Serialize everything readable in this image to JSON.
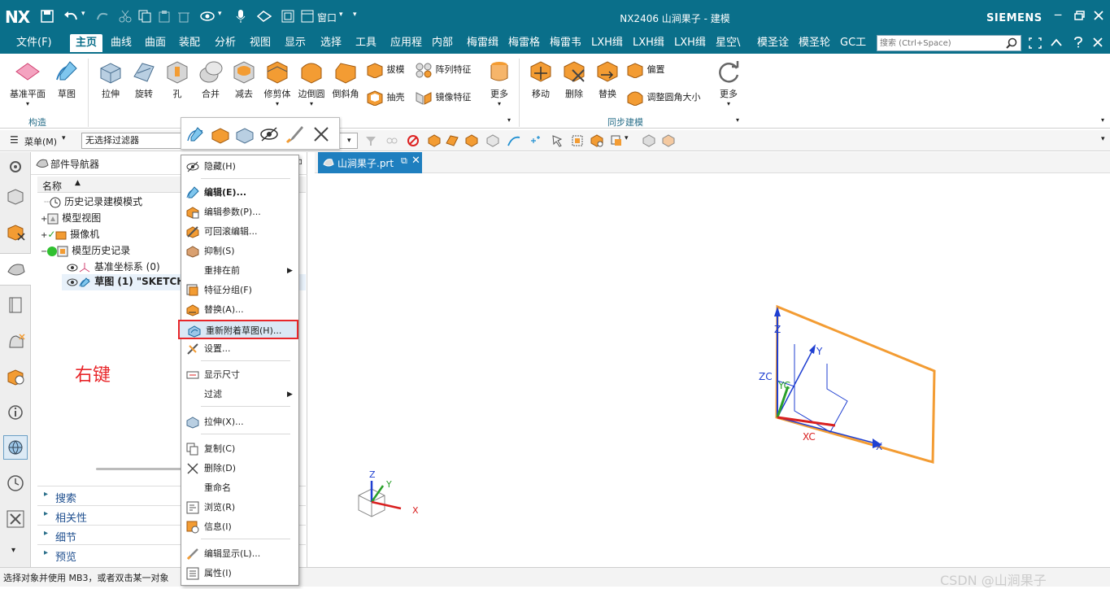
{
  "app": {
    "logo": "NX",
    "title": "NX2406 山涧果子 - 建模",
    "brand": "SIEMENS",
    "window_menu": "窗口"
  },
  "menubar": {
    "tabs": [
      "文件(F)",
      "主页",
      "曲线",
      "曲面",
      "装配",
      "分析",
      "视图",
      "显示",
      "选择",
      "工具",
      "应用程",
      "内部",
      "梅雷缉",
      "梅雷格",
      "梅雷韦",
      "LXH缉",
      "LXH缉",
      "LXH缉",
      "星空\\",
      "模圣诠",
      "模圣轮",
      "GC工"
    ],
    "search_placeholder": "搜索 (Ctrl+Space)"
  },
  "ribbon": {
    "construct": [
      "基准平面",
      "草图"
    ],
    "construct_label": "构造",
    "features": [
      "拉伸",
      "旋转",
      "孔",
      "合并",
      "减去",
      "修剪体",
      "边倒圆",
      "倒斜角"
    ],
    "features_small": [
      "拔模",
      "阵列特征",
      "抽壳",
      "镜像特征"
    ],
    "more": "更多",
    "sync": [
      "移动",
      "删除",
      "替换"
    ],
    "sync_small": [
      "偏置",
      "调整圆角大小"
    ],
    "sync_label": "同步建模",
    "more2": "更多"
  },
  "toolbar2": {
    "menu_label": "菜单(M)",
    "filter_value": "无选择过滤器"
  },
  "nav": {
    "title": "部件导航器",
    "col_name": "名称",
    "items": [
      "历史记录建模模式",
      "模型视图",
      "摄像机",
      "模型历史记录",
      "基准坐标系 (0)",
      "草图 (1) \"SKETCH"
    ],
    "annotation": "右键",
    "sections": [
      "搜索",
      "相关性",
      "细节",
      "预览"
    ]
  },
  "file_tab": {
    "name": "山涧果子.prt"
  },
  "context_menu": {
    "items": [
      "隐藏(H)",
      "编辑(E)...",
      "编辑参数(P)...",
      "可回滚编辑...",
      "抑制(S)",
      "重排在前",
      "特征分组(F)",
      "替换(A)...",
      "重新附着草图(H)...",
      "设置...",
      "显示尺寸",
      "过滤",
      "拉伸(X)...",
      "复制(C)",
      "删除(D)",
      "重命名",
      "浏览(R)",
      "信息(I)",
      "编辑显示(L)...",
      "属性(I)"
    ]
  },
  "viewport": {
    "axes": {
      "z": "Z",
      "y": "Y",
      "zc": "ZC",
      "yc": "YC",
      "xc": "XC",
      "x": "X"
    },
    "triad": {
      "z": "Z",
      "y": "Y",
      "x": "X"
    }
  },
  "status": {
    "prompt": "选择对象并使用 MB3，或者双击某一对象",
    "watermark": "CSDN @山涧果子"
  },
  "colors": {
    "title_bg": "#0a6f8a",
    "accent_orange": "#f39c33",
    "highlight_red": "#e8262a",
    "axis_blue": "#1f3fd1",
    "axis_red": "#d92020"
  }
}
